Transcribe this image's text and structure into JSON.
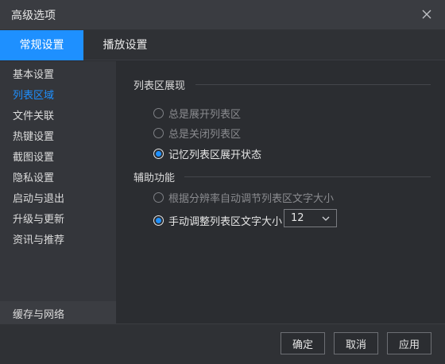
{
  "window": {
    "title": "高级选项"
  },
  "tabs": [
    {
      "label": "常规设置",
      "active": true
    },
    {
      "label": "播放设置",
      "active": false
    }
  ],
  "sidebar": {
    "items": [
      {
        "label": "基本设置"
      },
      {
        "label": "列表区域",
        "active": true
      },
      {
        "label": "文件关联"
      },
      {
        "label": "热键设置"
      },
      {
        "label": "截图设置"
      },
      {
        "label": "隐私设置"
      },
      {
        "label": "启动与退出"
      },
      {
        "label": "升级与更新"
      },
      {
        "label": "资讯与推荐"
      }
    ],
    "bottom_item": {
      "label": "缓存与网络"
    }
  },
  "main": {
    "list_display": {
      "title": "列表区展现",
      "options": [
        {
          "label": "总是展开列表区",
          "checked": false,
          "enabled": false
        },
        {
          "label": "总是关闭列表区",
          "checked": false,
          "enabled": false
        },
        {
          "label": "记忆列表区展开状态",
          "checked": true,
          "enabled": true
        }
      ]
    },
    "assist": {
      "title": "辅助功能",
      "options": [
        {
          "label": "根据分辨率自动调节列表区文字大小",
          "checked": false,
          "enabled": false
        },
        {
          "label": "手动调整列表区文字大小",
          "checked": true,
          "enabled": true
        }
      ],
      "font_size_select": {
        "value": "12"
      }
    }
  },
  "footer": {
    "ok_label": "确定",
    "cancel_label": "取消",
    "apply_label": "应用"
  },
  "colors": {
    "accent": "#1e90ff",
    "background": "#2b2d31",
    "sidebar": "#34363b"
  },
  "icons": {
    "close": "close-icon",
    "dropdown": "chevron-down-icon"
  }
}
